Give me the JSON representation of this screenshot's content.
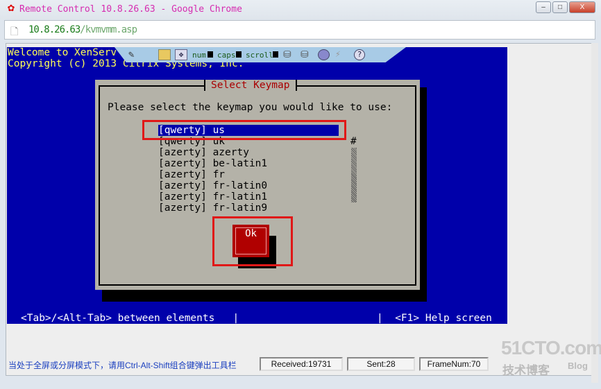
{
  "window": {
    "title": "Remote Control 10.8.26.63 - Google Chrome",
    "logo": "huawei-logo",
    "controls": [
      "minimize",
      "maximize",
      "close"
    ]
  },
  "address": {
    "host": "10.8.26.63",
    "path": "/kvmvmm.asp",
    "icon": "page-icon"
  },
  "console": {
    "line1": "Welcome to XenServ",
    "line2": "Copyright (c) 2013 Citrix Systems, Inc.",
    "footer_left": "<Tab>/<Alt-Tab> between elements   |",
    "footer_right": "|  <F1> Help screen"
  },
  "toolbar": {
    "num": "num",
    "caps": "caps",
    "scroll": "scroll",
    "icons": [
      "pin-icon",
      "ctrl-alt-del-icon",
      "move-icon",
      "floppy-icon",
      "cdrom-icon",
      "disc-icon",
      "power-icon",
      "help-icon"
    ]
  },
  "dialog": {
    "title": "Select Keymap",
    "prompt": "Please select the keymap you would like to use:",
    "items": [
      "[qwerty] us",
      "[qwerty] uk",
      "[azerty] azerty",
      "[azerty] be-latin1",
      "[azerty] fr",
      "[azerty] fr-latin0",
      "[azerty] fr-latin1",
      "[azerty] fr-latin9"
    ],
    "selected": "[qwerty] us",
    "scroll_marker": "#",
    "ok_label": "Ok"
  },
  "status": {
    "hint": "当处于全屏或分屏模式下，请用Ctrl-Alt-Shift组合键弹出工具栏",
    "received": "Received:19731",
    "sent": "Sent:28",
    "framenum": "FrameNum:70"
  },
  "watermark": {
    "site": "51CTO.com",
    "sub": "技术博客",
    "blog": "Blog"
  },
  "colors": {
    "console_bg": "#0000aa",
    "dialog_bg": "#b4b2a8",
    "title_red": "#aa0000",
    "highlight_box": "#e01818"
  }
}
